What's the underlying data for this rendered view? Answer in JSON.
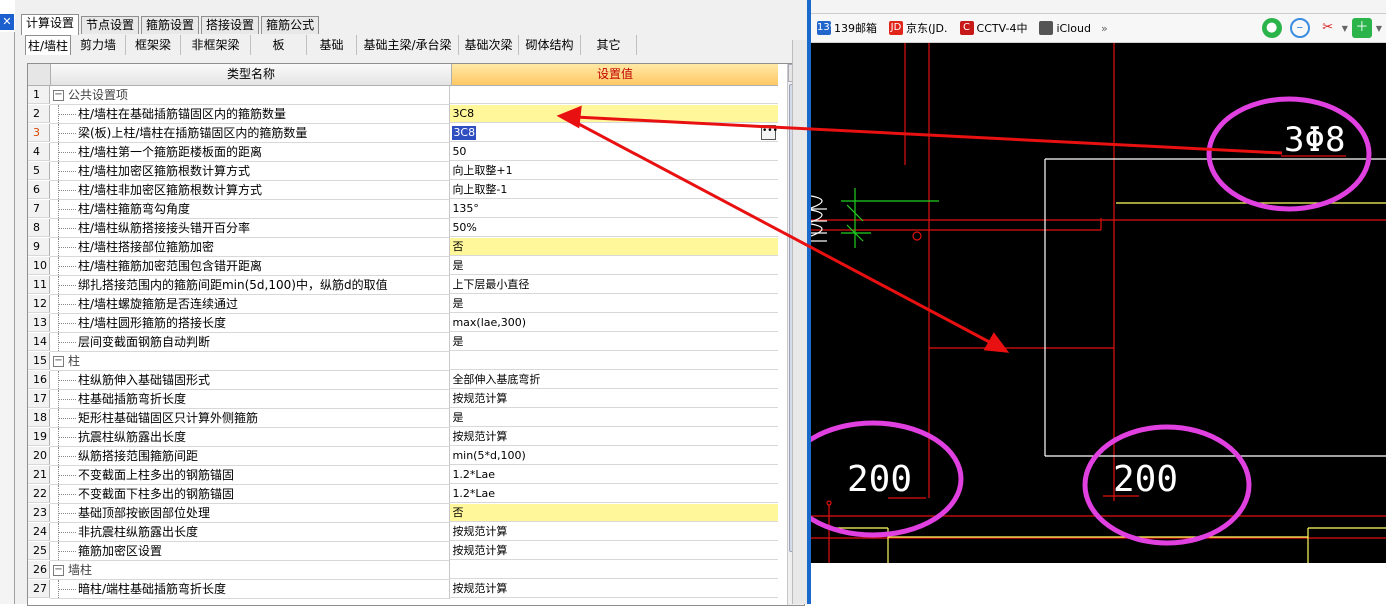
{
  "window": {
    "close_glyph": "✕"
  },
  "outer_tabs": [
    "计算设置",
    "节点设置",
    "箍筋设置",
    "搭接设置",
    "箍筋公式"
  ],
  "inner_tabs": [
    "柱/墙柱",
    "剪力墙",
    "框架梁",
    "非框架梁",
    "板",
    "基础",
    "基础主梁/承台梁",
    "基础次梁",
    "砌体结构",
    "其它"
  ],
  "grid": {
    "header_name": "类型名称",
    "header_value": "设置值",
    "rows": [
      {
        "n": "1",
        "name": "公共设置项",
        "val": "",
        "group": true
      },
      {
        "n": "2",
        "name": "柱/墙柱在基础插筋锚固区内的箍筋数量",
        "val": "3C8",
        "hl": true
      },
      {
        "n": "3",
        "name": "梁(板)上柱/墙柱在插筋锚固区内的箍筋数量",
        "val": "3C8",
        "edit": true,
        "sel": true
      },
      {
        "n": "4",
        "name": "柱/墙柱第一个箍筋距楼板面的距离",
        "val": "50"
      },
      {
        "n": "5",
        "name": "柱/墙柱加密区箍筋根数计算方式",
        "val": "向上取整+1"
      },
      {
        "n": "6",
        "name": "柱/墙柱非加密区箍筋根数计算方式",
        "val": "向上取整-1"
      },
      {
        "n": "7",
        "name": "柱/墙柱箍筋弯勾角度",
        "val": "135°"
      },
      {
        "n": "8",
        "name": "柱/墙柱纵筋搭接接头错开百分率",
        "val": "50%"
      },
      {
        "n": "9",
        "name": "柱/墙柱搭接部位箍筋加密",
        "val": "否",
        "hl": true
      },
      {
        "n": "10",
        "name": "柱/墙柱箍筋加密范围包含错开距离",
        "val": "是"
      },
      {
        "n": "11",
        "name": "绑扎搭接范围内的箍筋间距min(5d,100)中，纵筋d的取值",
        "val": "上下层最小直径"
      },
      {
        "n": "12",
        "name": "柱/墙柱螺旋箍筋是否连续通过",
        "val": "是"
      },
      {
        "n": "13",
        "name": "柱/墙柱圆形箍筋的搭接长度",
        "val": "max(lae,300)"
      },
      {
        "n": "14",
        "name": "层间变截面钢筋自动判断",
        "val": "是"
      },
      {
        "n": "15",
        "name": "柱",
        "val": "",
        "group": true
      },
      {
        "n": "16",
        "name": "柱纵筋伸入基础锚固形式",
        "val": "全部伸入基底弯折"
      },
      {
        "n": "17",
        "name": "柱基础插筋弯折长度",
        "val": "按规范计算"
      },
      {
        "n": "18",
        "name": "矩形柱基础锚固区只计算外侧箍筋",
        "val": "是"
      },
      {
        "n": "19",
        "name": "抗震柱纵筋露出长度",
        "val": "按规范计算"
      },
      {
        "n": "20",
        "name": "纵筋搭接范围箍筋间距",
        "val": "min(5*d,100)"
      },
      {
        "n": "21",
        "name": "不变截面上柱多出的钢筋锚固",
        "val": "1.2*Lae"
      },
      {
        "n": "22",
        "name": "不变截面下柱多出的钢筋锚固",
        "val": "1.2*Lae"
      },
      {
        "n": "23",
        "name": "基础顶部按嵌固部位处理",
        "val": "否",
        "hl": true
      },
      {
        "n": "24",
        "name": "非抗震柱纵筋露出长度",
        "val": "按规范计算"
      },
      {
        "n": "25",
        "name": "箍筋加密区设置",
        "val": "按规范计算"
      },
      {
        "n": "26",
        "name": "墙柱",
        "val": "",
        "group": true
      },
      {
        "n": "27",
        "name": "暗柱/端柱基础插筋弯折长度",
        "val": "按规范计算"
      }
    ]
  },
  "browser": {
    "bookmarks": [
      {
        "icon": "139",
        "icon_color": "#2266cc",
        "label": "139邮箱"
      },
      {
        "icon": "JD",
        "icon_color": "#e1251b",
        "label": "京东(JD."
      },
      {
        "icon": "C",
        "icon_color": "#c81919",
        "label": "CCTV-4中"
      },
      {
        "icon": "",
        "icon_color": "#555555",
        "label": "iCloud"
      }
    ],
    "more": "»"
  },
  "cad": {
    "annotations": [
      "3Φ8",
      "200",
      "200"
    ],
    "colors": {
      "background": "#000000",
      "red": "#e01010",
      "yellow": "#ffff60",
      "white": "#ffffff",
      "green": "#20d020",
      "circle": "#e040e0"
    }
  },
  "arrows_color": "#e81010"
}
